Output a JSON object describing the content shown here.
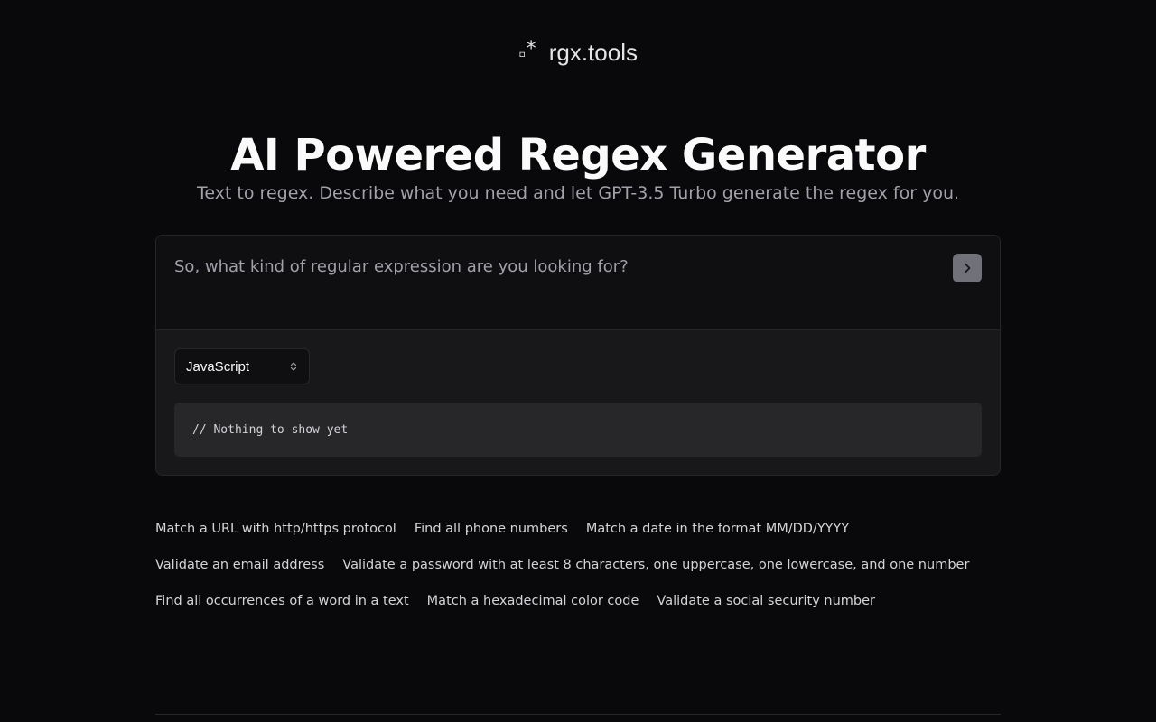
{
  "header": {
    "logo_icon": "regex-dot-star-icon",
    "logo_mark": ".*",
    "logo_text": "rgx.tools"
  },
  "hero": {
    "title": "AI Powered Regex Generator",
    "subtitle": "Text to regex. Describe what you need and let GPT-3.5 Turbo generate the regex for you."
  },
  "prompt": {
    "placeholder": "So, what kind of regular expression are you looking for?",
    "value": "",
    "submit_icon": "chevron-right-icon"
  },
  "language": {
    "selected": "JavaScript",
    "icon": "chevron-up-down-icon"
  },
  "output": {
    "text": "// Nothing to show yet"
  },
  "suggestions": [
    "Match a URL with http/https protocol",
    "Find all phone numbers",
    "Match a date in the format MM/DD/YYYY",
    "Validate an email address",
    "Validate a password with at least 8 characters, one uppercase, one lowercase, and one number",
    "Find all occurrences of a word in a text",
    "Match a hexadecimal color code",
    "Validate a social security number"
  ],
  "colors": {
    "background": "#09090b",
    "card_border": "#27272a",
    "submit_button": "#71717a",
    "muted_text": "#a1a1aa"
  }
}
